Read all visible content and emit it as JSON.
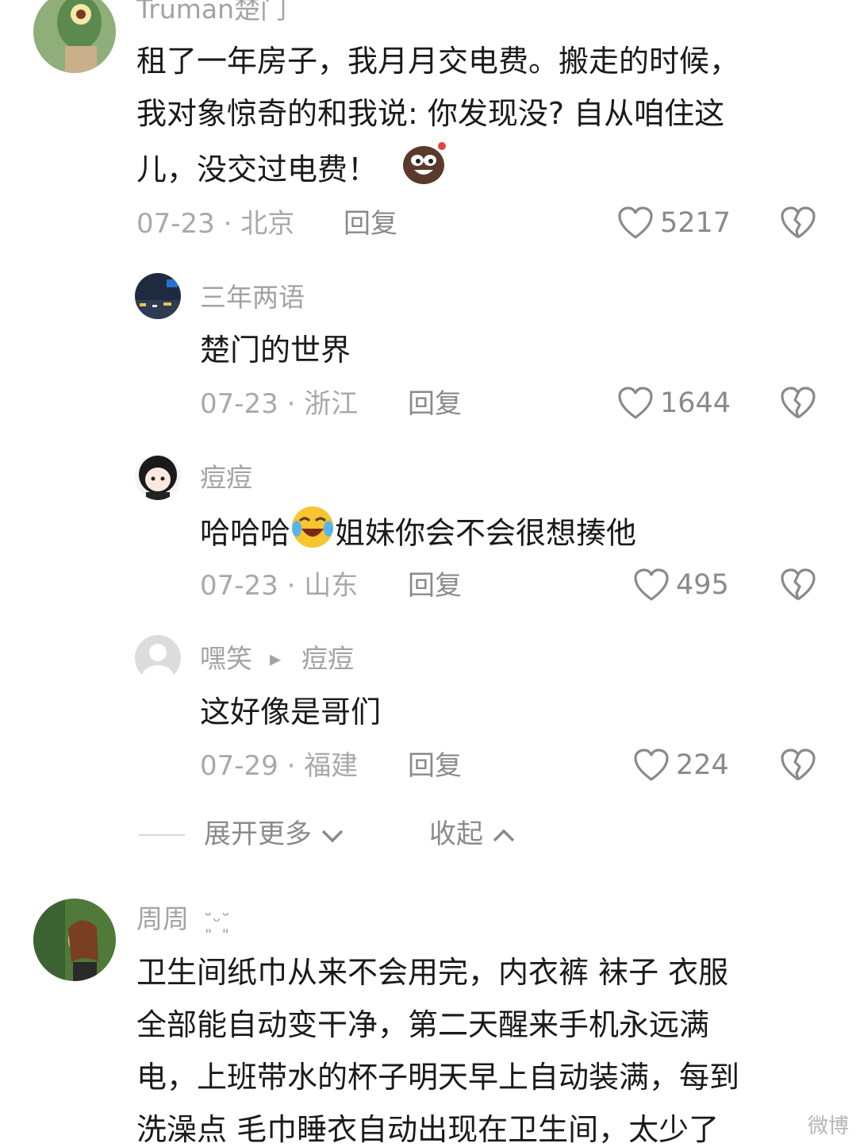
{
  "comments": [
    {
      "username": "Truman楚门",
      "lines": [
        "租了一年房子，我月月交电费。搬走的时候，",
        "我对象惊奇的和我说: 你发现没? 自从咱住这",
        "儿，没交过电费！"
      ],
      "emoji": "laughing-bean-emoji",
      "date_location": "07-23 · 北京",
      "reply_label": "回复",
      "likes": "5217"
    },
    {
      "username": "三年两语",
      "lines": [
        "楚门的世界"
      ],
      "date_location": "07-23 · 浙江",
      "reply_label": "回复",
      "likes": "1644"
    },
    {
      "username": "痘痘",
      "text_before_emoji": "哈哈哈",
      "emoji": "crying-laughing-emoji",
      "text_after_emoji": "姐妹你会不会很想揍他",
      "date_location": "07-23 · 山东",
      "reply_label": "回复",
      "likes": "495"
    },
    {
      "username": "嘿笑",
      "reply_to_arrow": "▸",
      "reply_to": "痘痘",
      "lines": [
        "这好像是哥们"
      ],
      "date_location": "07-29 · 福建",
      "reply_label": "回复",
      "likes": "224"
    },
    {
      "username": "周周",
      "username_suffix": "˘͈ᵕ˘͈",
      "lines": [
        "卫生间纸巾从来不会用完，内衣裤 袜子 衣服",
        "全部能自动变干净，第二天醒来手机永远满",
        "电，上班带水的杯子明天早上自动装满，每到",
        "洗澡点 毛巾睡衣自动出现在卫生间，太少了"
      ]
    }
  ],
  "expand": {
    "more_label": "展开更多",
    "collapse_label": "收起"
  },
  "watermark": "微博"
}
